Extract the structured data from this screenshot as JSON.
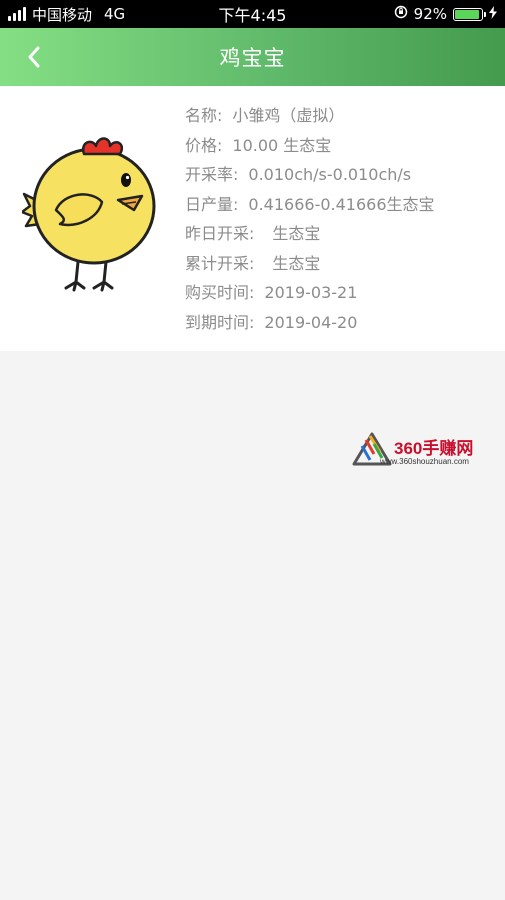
{
  "status_bar": {
    "carrier": "中国移动",
    "network": "4G",
    "time": "下午4:45",
    "battery_percent": "92%",
    "battery_level": 0.92
  },
  "nav": {
    "title": "鸡宝宝",
    "back_icon": "chevron-left-icon"
  },
  "product": {
    "image_icon": "chick-illustration",
    "name_label": "名称:",
    "name_value": "小雏鸡（虚拟）",
    "price_label": "价格:",
    "price_value": "10.00 生态宝",
    "rate_label": "开采率:",
    "rate_value": "0.010ch/s-0.010ch/s",
    "daily_label": "日产量:",
    "daily_value": "0.41666-0.41666生态宝",
    "yesterday_label": "昨日开采:",
    "yesterday_value": "生态宝",
    "total_label": "累计开采:",
    "total_value": "生态宝",
    "purchase_label": "购买时间:",
    "purchase_value": "2019-03-21",
    "expire_label": "到期时间:",
    "expire_value": "2019-04-20"
  },
  "watermark": {
    "brand": "360手赚网",
    "url": "www.360shouzhuan.com"
  },
  "colors": {
    "nav_gradient_start": "#84df84",
    "nav_gradient_end": "#449a4d",
    "label_text": "#8c8c8c",
    "page_bg": "#f4f4f4"
  }
}
